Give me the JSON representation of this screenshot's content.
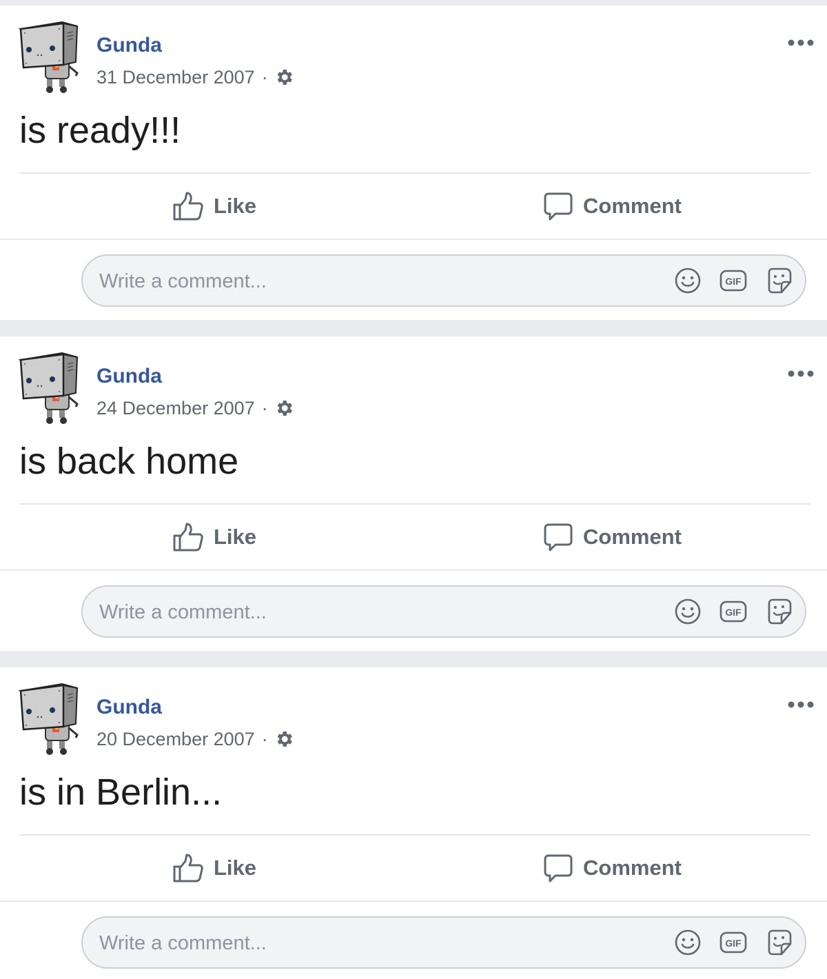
{
  "feed": {
    "posts": [
      {
        "author": "Gunda",
        "date": "31 December 2007",
        "separator": "·",
        "text": "is ready!!!",
        "like_label": "Like",
        "comment_label": "Comment",
        "comment_placeholder": "Write a comment..."
      },
      {
        "author": "Gunda",
        "date": "24 December 2007",
        "separator": "·",
        "text": "is back home",
        "like_label": "Like",
        "comment_label": "Comment",
        "comment_placeholder": "Write a comment..."
      },
      {
        "author": "Gunda",
        "date": "20 December 2007",
        "separator": "·",
        "text": "is in Berlin...",
        "like_label": "Like",
        "comment_label": "Comment",
        "comment_placeholder": "Write a comment..."
      }
    ]
  },
  "icons": {
    "audience": "gear-icon",
    "more": "more-options-icon",
    "like": "thumbs-up-icon",
    "comment": "speech-bubble-icon",
    "emoji": "smiley-icon",
    "gif": "gif-icon",
    "sticker": "sticker-icon"
  },
  "colors": {
    "author_link": "#365899",
    "secondary_text": "#606770",
    "post_text": "#1c1e21",
    "feed_background": "#e9ebee",
    "card_background": "#ffffff",
    "input_background": "#f2f3f5"
  }
}
